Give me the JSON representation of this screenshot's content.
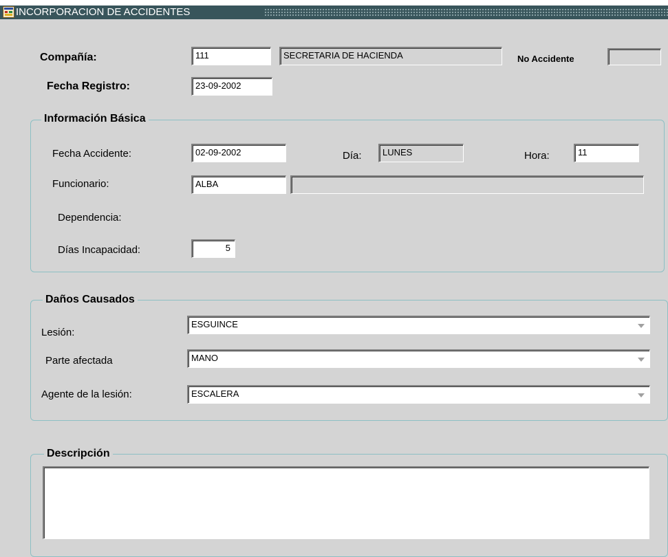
{
  "window": {
    "title": "INCORPORACION DE ACCIDENTES",
    "icon": "forms-app-icon"
  },
  "header": {
    "compania_label": "Compañía:",
    "compania_code": "111",
    "compania_name": "SECRETARIA DE HACIENDA",
    "no_accidente_label": "No Accidente",
    "no_accidente_value": "",
    "fecha_registro_label": "Fecha Registro:",
    "fecha_registro_value": "23-09-2002"
  },
  "info_basica": {
    "title": "Información Básica",
    "fecha_accidente_label": "Fecha Accidente:",
    "fecha_accidente_value": "02-09-2002",
    "dia_label": "Día:",
    "dia_value": "LUNES",
    "hora_label": "Hora:",
    "hora_value": "11",
    "funcionario_label": "Funcionario:",
    "funcionario_value": "ALBA",
    "funcionario_name": "",
    "dependencia_label": "Dependencia:",
    "dias_incapacidad_label": "Días Incapacidad:",
    "dias_incapacidad_value": "5"
  },
  "danos": {
    "title": "Daños Causados",
    "lesion_label": "Lesión:",
    "lesion_value": "ESGUINCE",
    "parte_label": "Parte afectada",
    "parte_value": "MANO",
    "agente_label": "Agente de la lesión:",
    "agente_value": "ESCALERA"
  },
  "descripcion": {
    "title": "Descripción",
    "value": ""
  },
  "colors": {
    "background": "#d4d4d4",
    "titlebar": "#38555b",
    "frame_border": "#8cbfc4"
  }
}
